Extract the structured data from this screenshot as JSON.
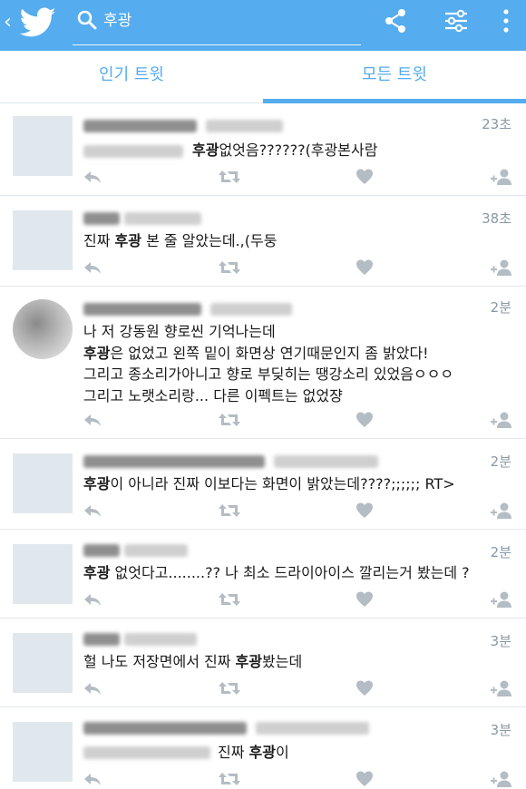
{
  "header": {
    "back_glyph": "‹",
    "search_query": "후광",
    "icons": [
      "back-icon",
      "twitter-bird-icon",
      "search-icon",
      "share-icon",
      "filter-icon",
      "more-icon"
    ]
  },
  "tabs": [
    {
      "label": "인기 트윗",
      "selected": false
    },
    {
      "label": "모든 트윗",
      "selected": true
    }
  ],
  "colors": {
    "accent": "#55acee",
    "divider": "#e1e8ed",
    "muted": "#8899a6"
  },
  "tweets": [
    {
      "time": "23초",
      "lines": [
        {
          "before": "",
          "highlight": "후광",
          "after": "없엇음??????(후광본사람"
        }
      ]
    },
    {
      "time": "38초",
      "lines": [
        {
          "before": "진짜 ",
          "highlight": "후광",
          "after": " 본 줄 알았는데.,(두둥"
        }
      ]
    },
    {
      "time": "2분",
      "lines": [
        {
          "before": "나 저 강동원 향로씬 기억나는데",
          "highlight": "",
          "after": ""
        },
        {
          "before": "",
          "highlight": "후광",
          "after": "은 없었고 왼쪽 밑이 화면상 연기때문인지 좀 밝았다!"
        },
        {
          "before": "그리고 종소리가아니고 향로 부딪히는 땡강소리 있었음ㅇㅇㅇ",
          "highlight": "",
          "after": ""
        },
        {
          "before": "그리고 노랫소리랑... 다른 이펙트는 없었쟝",
          "highlight": "",
          "after": ""
        }
      ]
    },
    {
      "time": "2분",
      "lines": [
        {
          "before": "",
          "highlight": "후광",
          "after": "이 아니라 진짜 이보다는 화면이 밝았는데????;;;;;; RT>"
        }
      ]
    },
    {
      "time": "2분",
      "lines": [
        {
          "before": "",
          "highlight": "후광",
          "after": " 없엇다고........?? 나 최소 드라이아이스 깔리는거 봤는데 ?"
        }
      ]
    },
    {
      "time": "3분",
      "lines": [
        {
          "before": "헐 나도 저장면에서 진짜 ",
          "highlight": "후광",
          "after": "봤는데"
        }
      ]
    },
    {
      "time": "3분",
      "lines": [
        {
          "before": "진짜 ",
          "highlight": "후광",
          "after": "이"
        }
      ]
    }
  ],
  "action_icons": [
    "reply-icon",
    "retweet-icon",
    "like-icon",
    "follow-icon"
  ]
}
